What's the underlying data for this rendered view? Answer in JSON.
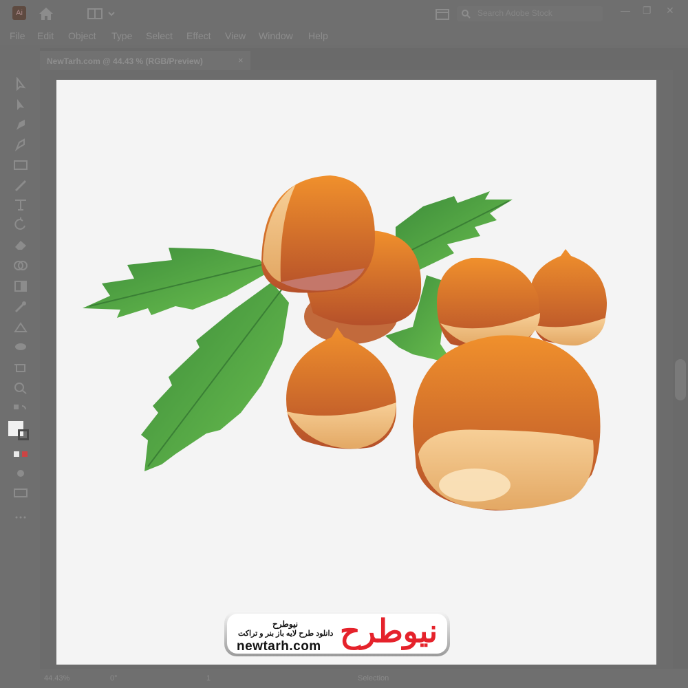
{
  "app": {
    "logo_text": "Ai"
  },
  "search": {
    "placeholder": "Search Adobe Stock"
  },
  "menu": [
    "File",
    "Edit",
    "Object",
    "Type",
    "Select",
    "Effect",
    "View",
    "Window",
    "Help"
  ],
  "document": {
    "tab_title": "NewTarh.com @ 44.43 % (RGB/Preview)",
    "close_symbol": "×"
  },
  "window_controls": {
    "minimize": "—",
    "restore": "❐",
    "close": "✕"
  },
  "status": {
    "zoom": "44.43%",
    "rotation": "0°",
    "artboard": "1",
    "mode": "Selection"
  },
  "watermark": {
    "brand_fa": "نیوطرح",
    "tagline_fa": "دانلود طرح لایه باز بنر و تراکت",
    "domain": "newtarh.com",
    "logo_fa": "نیوطرح"
  },
  "colors": {
    "nut_shell": "#c8652a",
    "nut_light": "#f3b979",
    "leaf": "#4fa845",
    "brand_red": "#e5222b"
  }
}
